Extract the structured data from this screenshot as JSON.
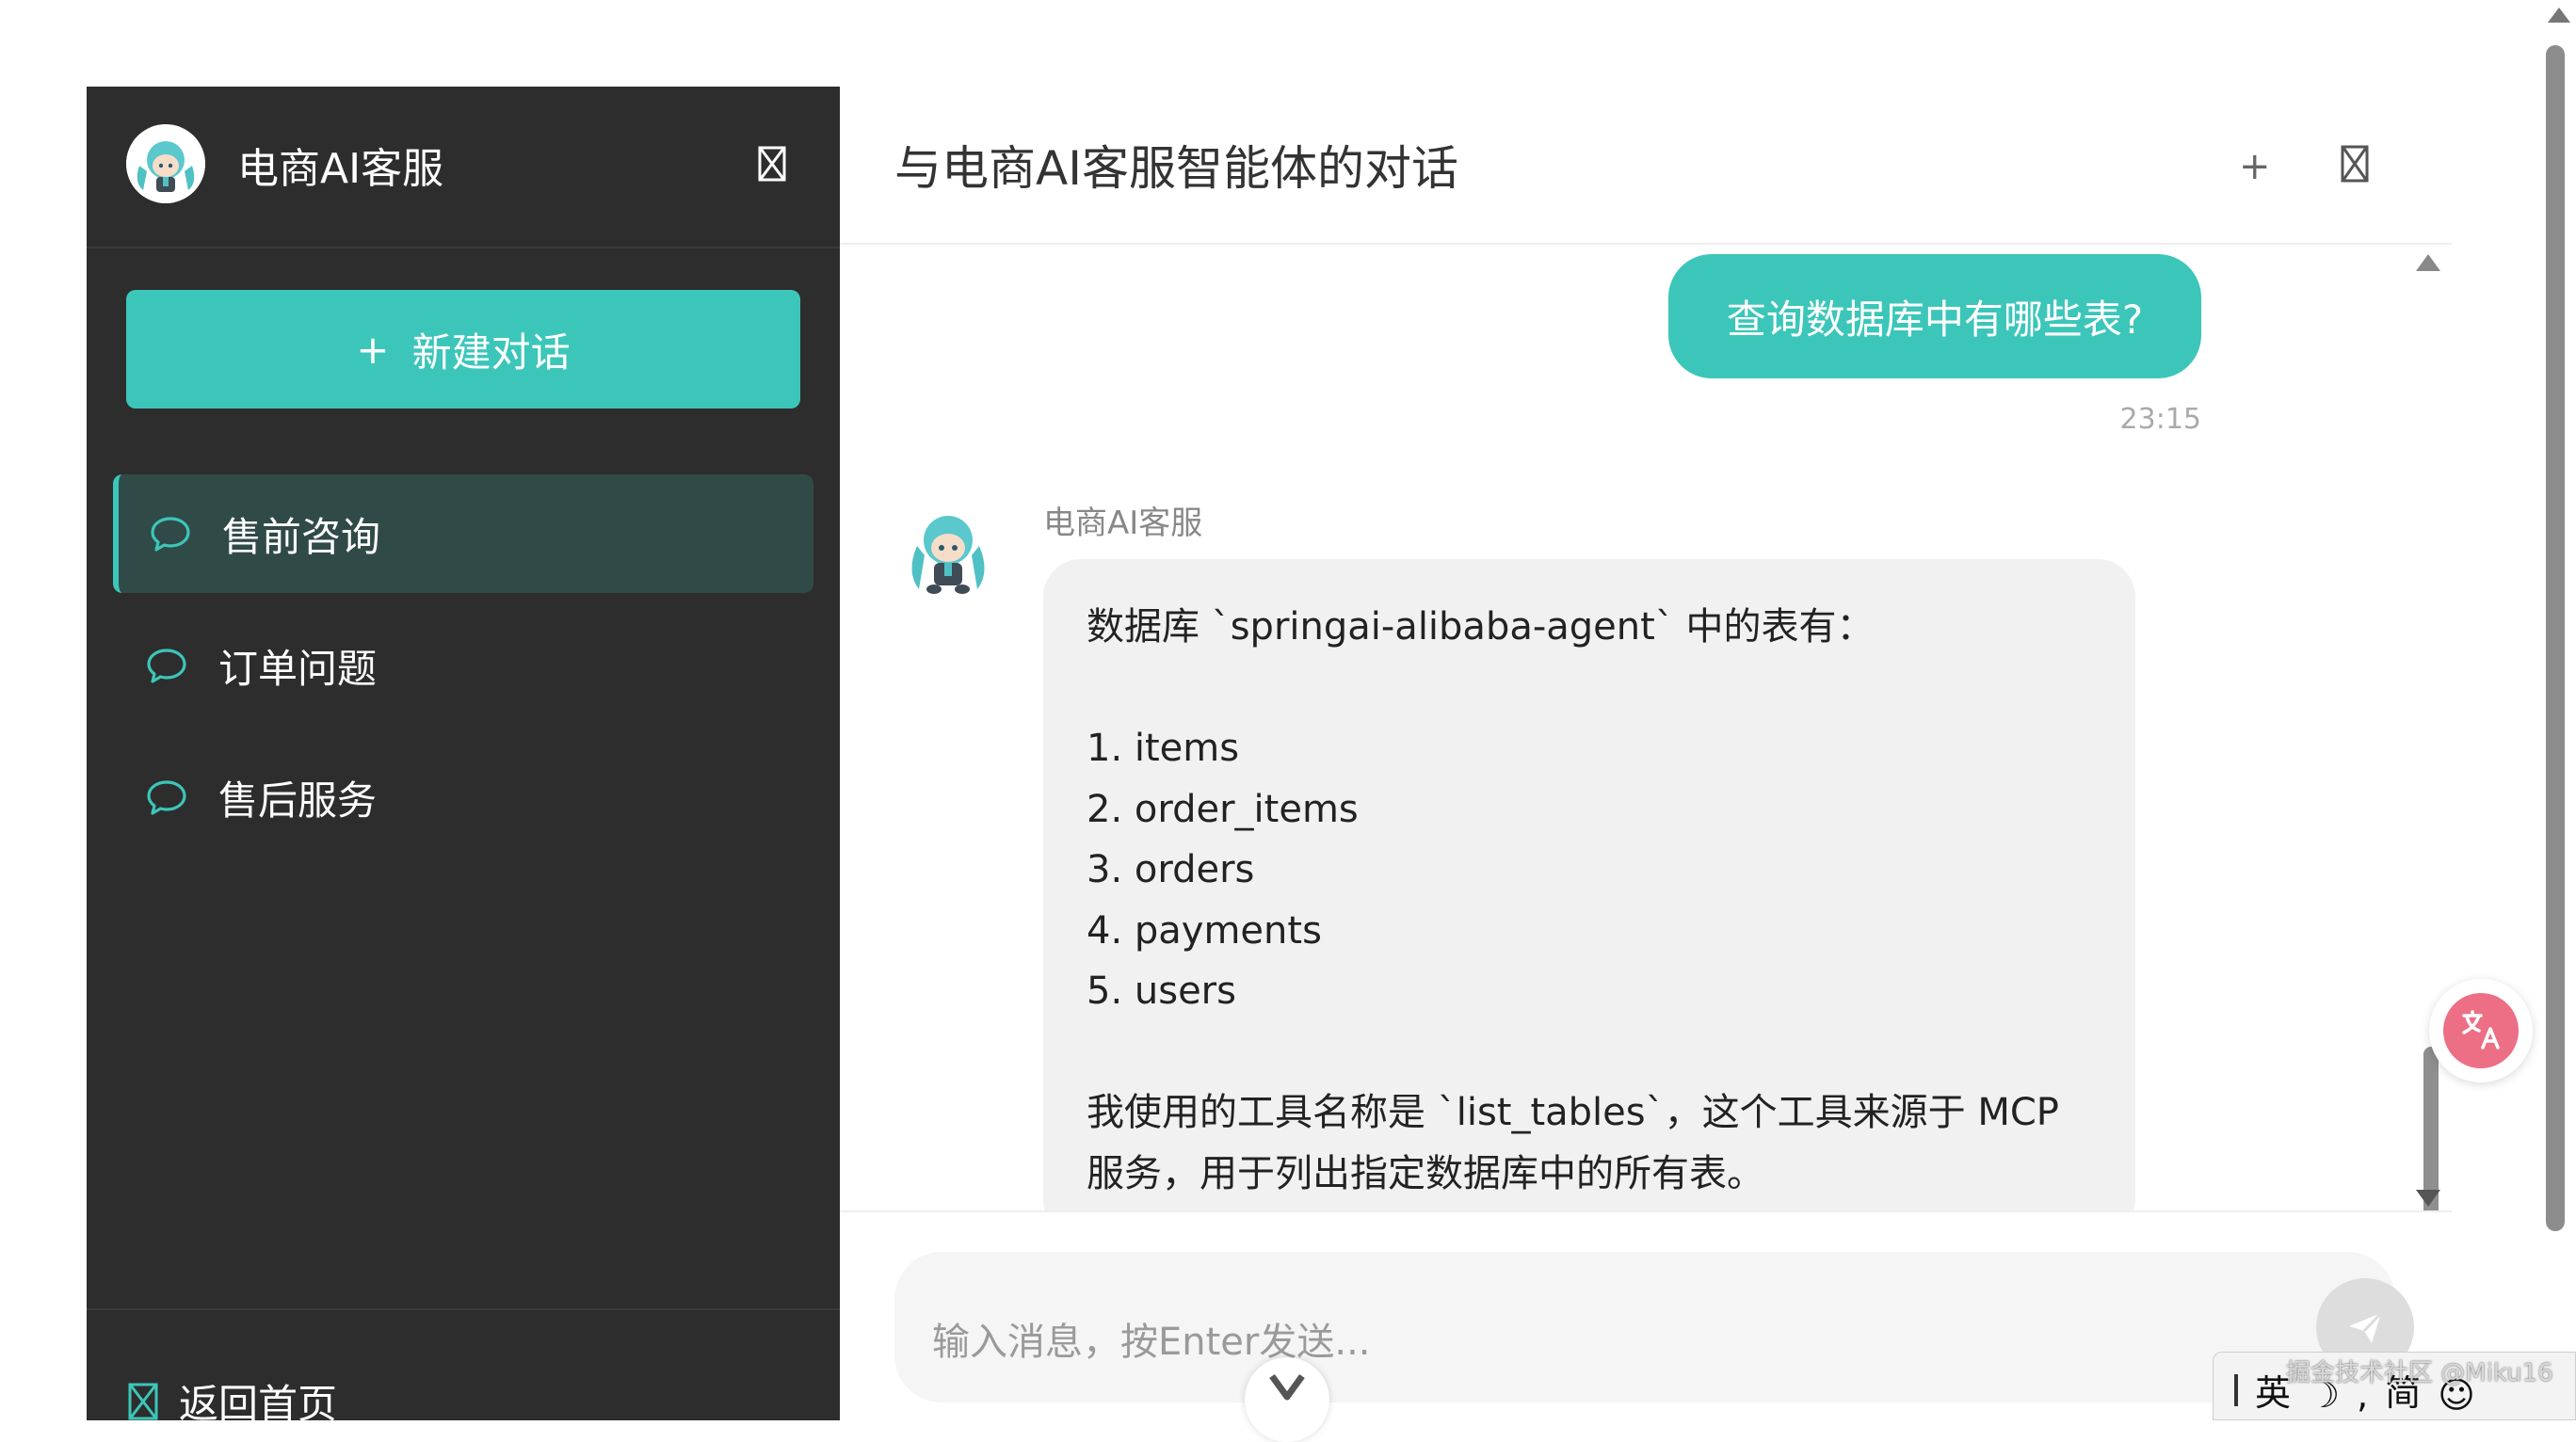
{
  "colors": {
    "accent": "#3cc6b9",
    "sidebar_bg": "#2d2d2d",
    "active_item_bg": "#304a47",
    "bot_bubble_bg": "#f1f1f1",
    "translate_badge": "#ec6f86"
  },
  "sidebar": {
    "title": "电商AI客服",
    "new_chat_label": "新建对话",
    "items": [
      {
        "label": "售前咨询",
        "icon": "chat-bubble-icon",
        "active": true
      },
      {
        "label": "订单问题",
        "icon": "chat-bubble-icon",
        "active": false
      },
      {
        "label": "售后服务",
        "icon": "chat-bubble-icon",
        "active": false
      }
    ],
    "back_home_label": "返回首页"
  },
  "header": {
    "title": "与电商AI客服智能体的对话",
    "new_button": "+"
  },
  "messages": {
    "user": {
      "text": "查询数据库中有哪些表?",
      "time": "23:15"
    },
    "bot": {
      "name": "电商AI客服",
      "text": "数据库 `springai-alibaba-agent` 中的表有：\n\n1. items\n2. order_items\n3. orders\n4. payments\n5. users\n\n我使用的工具名称是 `list_tables`，这个工具来源于 MCP 服务，用于列出指定数据库中的所有表。"
    }
  },
  "input": {
    "placeholder": "输入消息，按Enter发送..."
  },
  "ime": {
    "lang": "英",
    "mode": "简"
  },
  "watermark": "掘金技术社区 @Miku16"
}
